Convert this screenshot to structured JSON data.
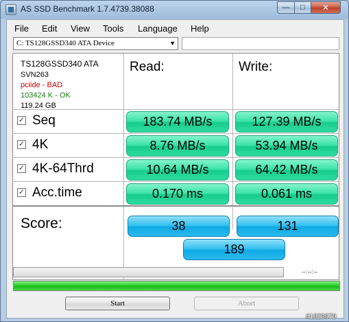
{
  "window": {
    "title": "AS SSD Benchmark 1.7.4739.38088",
    "controls": {
      "minimize": "—",
      "maximize": "□",
      "close": "✕"
    }
  },
  "menu": [
    "File",
    "Edit",
    "View",
    "Tools",
    "Language",
    "Help"
  ],
  "drive": {
    "selected": "C: TS128GSSD340 ATA Device",
    "extra": ""
  },
  "info": {
    "model": "TS128GSSD340 ATA",
    "firmware": "SVN263",
    "driver": "pciide - BAD",
    "alignment": "103424 K - OK",
    "size": "119.24 GB"
  },
  "headers": {
    "read": "Read:",
    "write": "Write:"
  },
  "rows": [
    {
      "label": "Seq",
      "checked": "✓",
      "read": "183.74 MB/s",
      "write": "127.39 MB/s"
    },
    {
      "label": "4K",
      "checked": "✓",
      "read": "8.76 MB/s",
      "write": "53.94 MB/s"
    },
    {
      "label": "4K-64Thrd",
      "checked": "✓",
      "read": "10.64 MB/s",
      "write": "64.42 MB/s"
    },
    {
      "label": "Acc.time",
      "checked": "✓",
      "read": "0.170 ms",
      "write": "0.061 ms"
    }
  ],
  "score": {
    "label": "Score:",
    "read": "38",
    "write": "131",
    "total": "189"
  },
  "progress": {
    "elapsed": "--:--:--",
    "test_fraction": 0,
    "total_fraction": 1
  },
  "buttons": {
    "start": "Start",
    "abort": "Abort"
  },
  "watermark": "#1829979",
  "colors": {
    "result_green": "#2fdca0",
    "score_blue": "#2ab9ee",
    "driver_bad": "#c00000",
    "alignment_ok": "#1a7a1a"
  }
}
